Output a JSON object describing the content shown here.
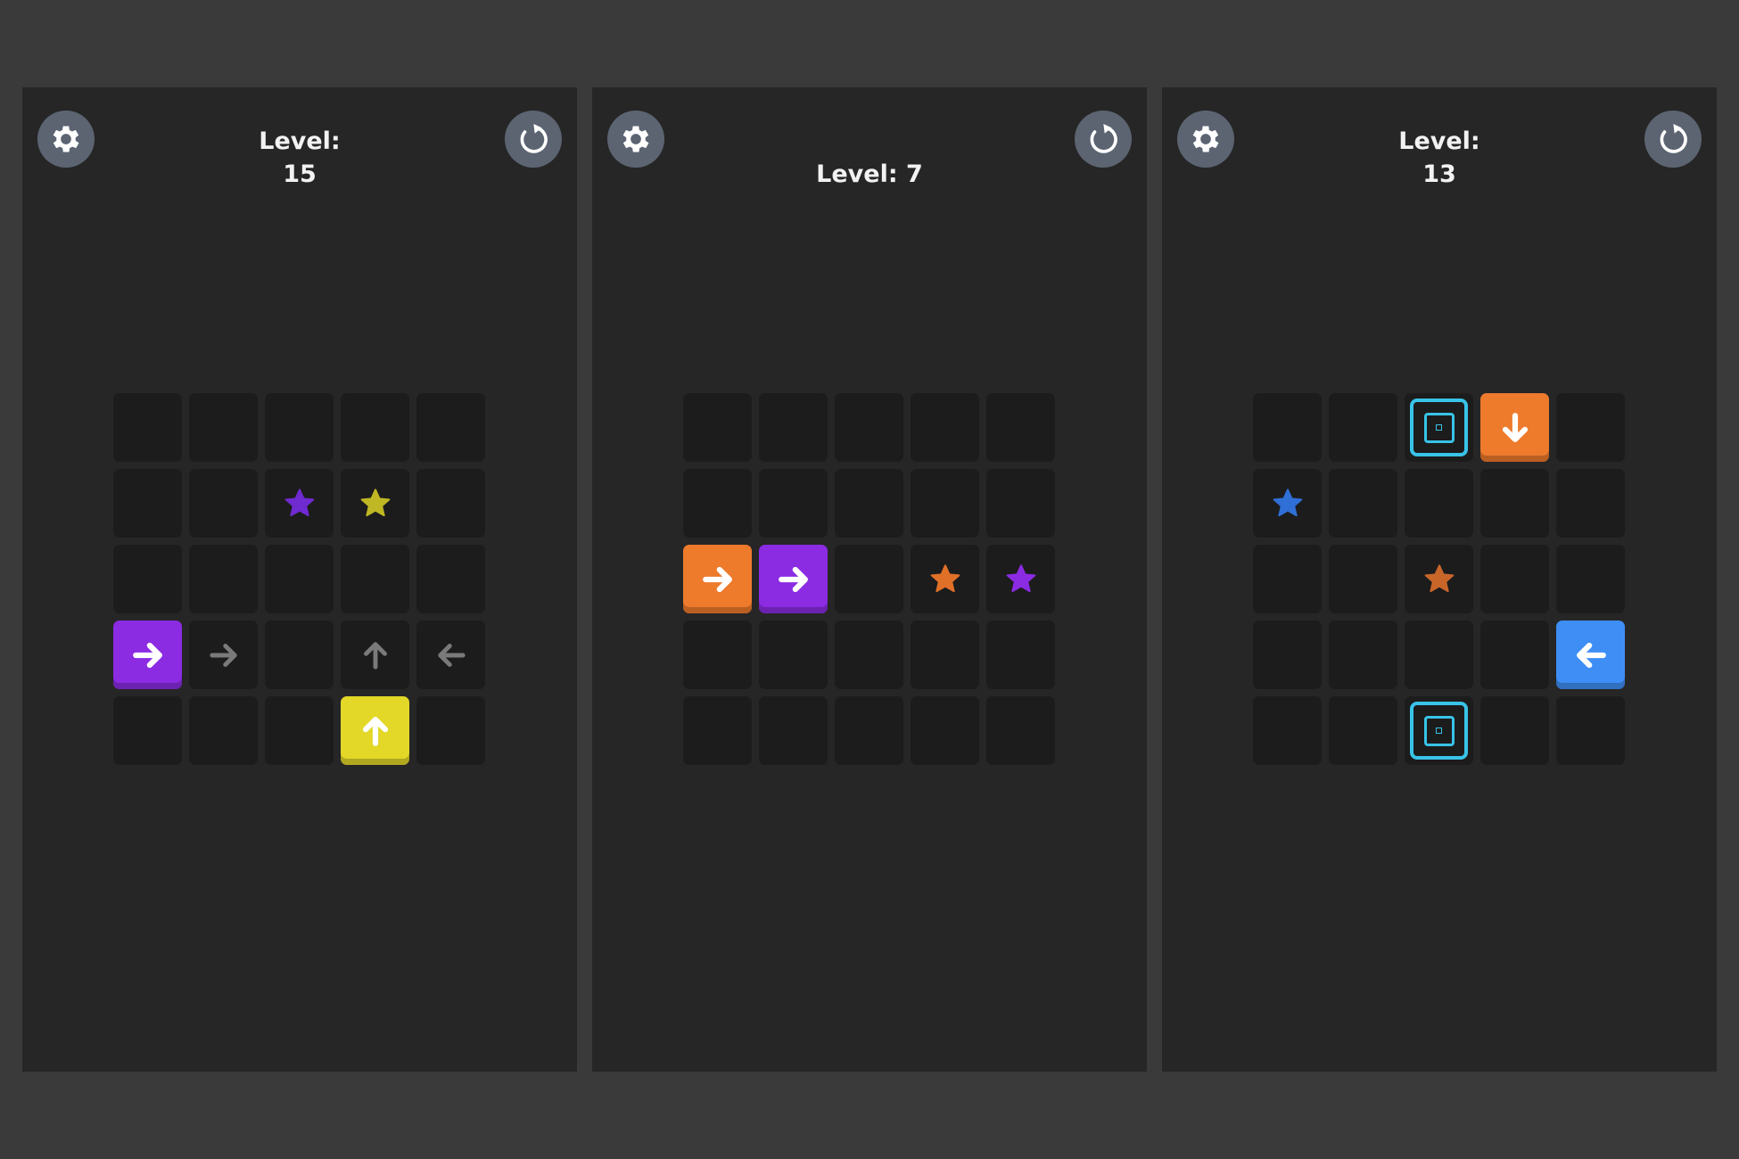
{
  "colors": {
    "background": "#3a3a3a",
    "panel": "#262626",
    "cell": "#1c1c1c",
    "button": "#5c6472",
    "hint_arrow": "#7a7a7a",
    "purple_block": "#8b2be2",
    "purple_star": "#6f2ad0",
    "yellow_block": "#e3d728",
    "yellow_star": "#bfb724",
    "orange_block": "#ee7a2c",
    "orange_star": "#e07028",
    "blue_block": "#3f8ef5",
    "blue_star": "#2f6fd6",
    "portal": "#38c3e8"
  },
  "icons": {
    "settings": "gear-icon",
    "restart": "restart-icon",
    "star": "star-icon",
    "arrow": "arrow-icon",
    "portal": "portal-icon"
  },
  "panels": [
    {
      "level_label": "Level:",
      "level_number": "15",
      "level_full": "",
      "cells": [
        {
          "row": 1,
          "col": 2,
          "type": "star",
          "color": "#6f2ad0"
        },
        {
          "row": 1,
          "col": 3,
          "type": "star",
          "color": "#bfb724"
        },
        {
          "row": 3,
          "col": 0,
          "type": "block",
          "color": "#8b2be2",
          "dir": "right"
        },
        {
          "row": 3,
          "col": 1,
          "type": "hint",
          "dir": "right"
        },
        {
          "row": 3,
          "col": 3,
          "type": "hint",
          "dir": "up"
        },
        {
          "row": 3,
          "col": 4,
          "type": "hint",
          "dir": "left"
        },
        {
          "row": 4,
          "col": 3,
          "type": "block",
          "color": "#e3d728",
          "dir": "up"
        }
      ]
    },
    {
      "level_label": "",
      "level_number": "",
      "level_full": "Level: 7",
      "cells": [
        {
          "row": 2,
          "col": 0,
          "type": "block",
          "color": "#ee7a2c",
          "dir": "right"
        },
        {
          "row": 2,
          "col": 1,
          "type": "block",
          "color": "#8b2be2",
          "dir": "right"
        },
        {
          "row": 2,
          "col": 3,
          "type": "star",
          "color": "#e07028"
        },
        {
          "row": 2,
          "col": 4,
          "type": "star",
          "color": "#8b2be2"
        }
      ]
    },
    {
      "level_label": "Level:",
      "level_number": "13",
      "level_full": "",
      "cells": [
        {
          "row": 0,
          "col": 2,
          "type": "portal"
        },
        {
          "row": 0,
          "col": 3,
          "type": "block",
          "color": "#ee7a2c",
          "dir": "down"
        },
        {
          "row": 1,
          "col": 0,
          "type": "star",
          "color": "#2f6fd6"
        },
        {
          "row": 2,
          "col": 2,
          "type": "star",
          "color": "#c8662a"
        },
        {
          "row": 3,
          "col": 4,
          "type": "block",
          "color": "#3f8ef5",
          "dir": "left"
        },
        {
          "row": 4,
          "col": 2,
          "type": "portal"
        }
      ]
    }
  ]
}
